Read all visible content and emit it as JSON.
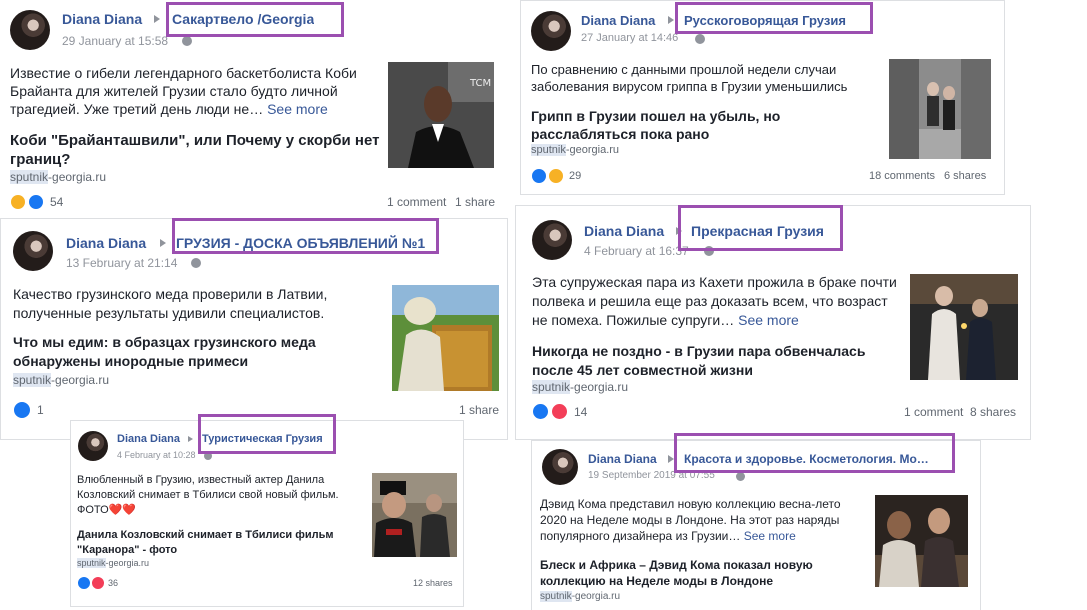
{
  "posts": [
    {
      "author": "Diana Diana",
      "group": "Сакартвело /Georgia",
      "date": "29 January at 15:58",
      "text": "Известие о гибели легендарного баскетболиста Коби Брайанта для жителей Грузии стало будто личной трагедией. Уже третий день люди не…",
      "see_more": "See more",
      "headline": "Коби \"Брайанташвили\", или Почему у скорби нет границ?",
      "source_highlight": "sputnik",
      "source_rest": "-georgia.ru",
      "reaction_count": "54",
      "comments": "1 comment",
      "shares": "1 share"
    },
    {
      "author": "Diana Diana",
      "group": "Русскоговорящая Грузия",
      "date": "27 January at 14:46",
      "text": "По сравнению с данными прошлой недели случаи заболевания вирусом гриппа в Грузии уменьшились",
      "headline": "Грипп в Грузии пошел на убыль, но расслабляться пока рано",
      "source_highlight": "sputnik",
      "source_rest": "-georgia.ru",
      "reaction_count": "29",
      "comments": "18 comments",
      "shares": "6 shares"
    },
    {
      "author": "Diana Diana",
      "group": "ГРУЗИЯ - ДОСКА ОБЪЯВЛЕНИЙ №1",
      "date": "13 February at 21:14",
      "text": "Качество грузинского меда проверили в Латвии, полученные результаты удивили специалистов.",
      "headline": "Что мы едим: в образцах грузинского меда обнаружены инородные примеси",
      "source_highlight": "sputnik",
      "source_rest": "-georgia.ru",
      "reaction_count": "1",
      "shares": "1 share"
    },
    {
      "author": "Diana Diana",
      "group": "Прекрасная Грузия",
      "date": "4 February at 16:37",
      "text": "Эта супружеская пара из Кахети прожила в браке почти полвека и решила еще раз доказать всем, что возраст не помеха. Пожилые супруги…",
      "see_more": "See more",
      "headline": "Никогда не поздно - в Грузии пара обвенчалась после 45 лет совместной жизни",
      "source_highlight": "sputnik",
      "source_rest": "-georgia.ru",
      "reaction_count": "14",
      "comments": "1 comment",
      "shares": "8 shares"
    },
    {
      "author": "Diana Diana",
      "group": "Туристическая Грузия",
      "date": "4 February at 10:28",
      "text": "Влюбленный в Грузию, известный актер Данила Козловский снимает в Тбилиси свой новый фильм. ФОТО❤️❤️",
      "headline": "Данила Козловский снимает в Тбилиси фильм \"Каранора\" - фото",
      "source_highlight": "sputnik",
      "source_rest": "-georgia.ru",
      "reaction_count": "36",
      "shares": "12 shares"
    },
    {
      "author": "Diana Diana",
      "group": "Красота и здоровье. Косметология. Мо…",
      "date": "19 September 2019 at 07:55",
      "text": "Дэвид Кома представил новую коллекцию весна-лето 2020 на Неделе моды в Лондоне. На этот раз наряды популярного дизайнера из Грузии…",
      "see_more": "See more",
      "headline": "Блеск и Африка – Дэвид Кома показал новую коллекцию на Неделе моды в Лондоне",
      "source_highlight": "sputnik",
      "source_rest": "-georgia.ru"
    }
  ],
  "colors": {
    "author": "#385898",
    "highlight_box": "#9b4fb0",
    "like": "#1877f2",
    "love": "#f33e58",
    "sad": "#f7b125"
  },
  "icons": {
    "audience": "globe-icon",
    "separator": "triangle-right-icon",
    "reactions": [
      "sad-reaction-icon",
      "like-reaction-icon",
      "wow-reaction-icon",
      "love-reaction-icon"
    ]
  }
}
